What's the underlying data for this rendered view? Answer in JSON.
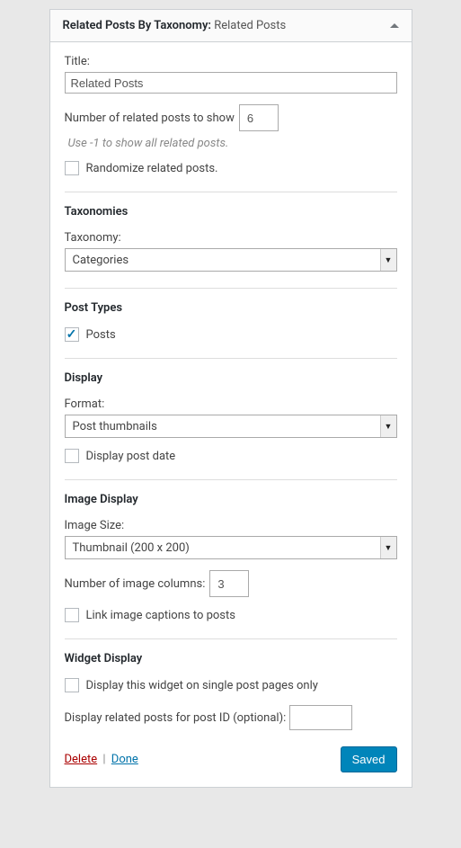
{
  "header": {
    "title_prefix": "Related Posts By Taxonomy:",
    "title_suffix": "Related Posts"
  },
  "title_field": {
    "label": "Title:",
    "value": "Related Posts"
  },
  "num_posts": {
    "label": "Number of related posts to show",
    "value": "6",
    "desc": "Use -1 to show all related posts."
  },
  "randomize": {
    "label": "Randomize related posts.",
    "checked": false
  },
  "taxonomies": {
    "heading": "Taxonomies",
    "label": "Taxonomy:",
    "value": "Categories"
  },
  "post_types": {
    "heading": "Post Types",
    "posts_label": "Posts",
    "posts_checked": true
  },
  "display": {
    "heading": "Display",
    "format_label": "Format:",
    "format_value": "Post thumbnails",
    "date_label": "Display post date",
    "date_checked": false
  },
  "image_display": {
    "heading": "Image Display",
    "size_label": "Image Size:",
    "size_value": "Thumbnail (200 x 200)",
    "cols_label": "Number of image columns:",
    "cols_value": "3",
    "link_label": "Link image captions to posts",
    "link_checked": false
  },
  "widget_display": {
    "heading": "Widget Display",
    "single_label": "Display this widget on single post pages only",
    "single_checked": false,
    "postid_label": "Display related posts for post ID (optional):",
    "postid_value": ""
  },
  "footer": {
    "delete": "Delete",
    "sep": "|",
    "done": "Done",
    "saved": "Saved"
  }
}
